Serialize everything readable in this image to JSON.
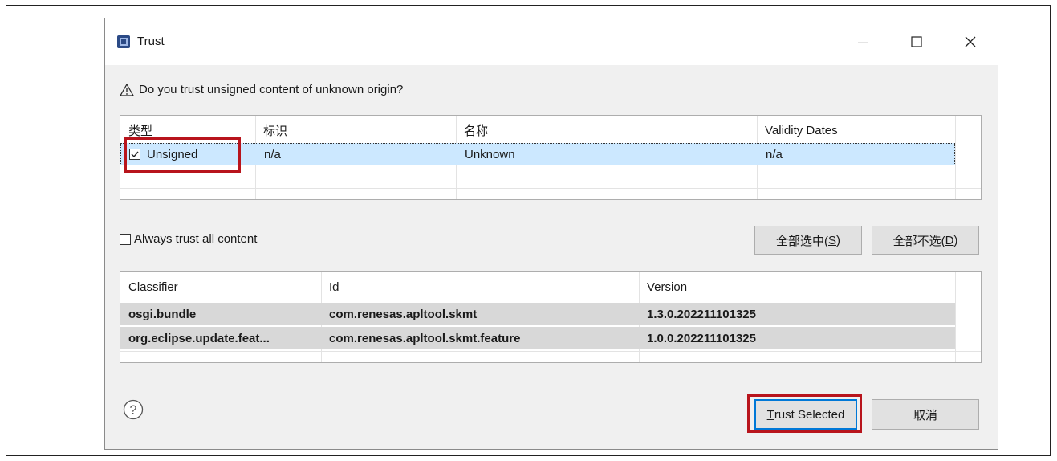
{
  "dialog": {
    "title": "Trust",
    "question": "Do you trust unsigned content of unknown origin?"
  },
  "certs_table": {
    "headers": [
      "类型",
      "标识",
      "名称",
      "Validity Dates"
    ],
    "rows": [
      {
        "type": "Unsigned",
        "id": "n/a",
        "name": "Unknown",
        "validity": "n/a",
        "checked": true
      }
    ]
  },
  "always_trust": {
    "label": "Always trust all content",
    "checked": false
  },
  "buttons": {
    "select_all": "全部选中(S)",
    "select_all_prefix": "全部选中(",
    "select_all_key": "S",
    "deselect_all_prefix": "全部不选(",
    "deselect_all_key": "D",
    "trust_selected_key": "T",
    "trust_selected_rest": "rust Selected",
    "cancel": "取消"
  },
  "artifacts_table": {
    "headers": [
      "Classifier",
      "Id",
      "Version"
    ],
    "rows": [
      {
        "classifier": "osgi.bundle",
        "id": "com.renesas.apltool.skmt",
        "version": "1.3.0.202211101325"
      },
      {
        "classifier": "org.eclipse.update.feat...",
        "id": "com.renesas.apltool.skmt.feature",
        "version": "1.0.0.202211101325"
      }
    ]
  },
  "colors": {
    "highlight_red": "#b8141c",
    "selection_blue": "#cce8ff",
    "accent_blue": "#0078d7"
  }
}
